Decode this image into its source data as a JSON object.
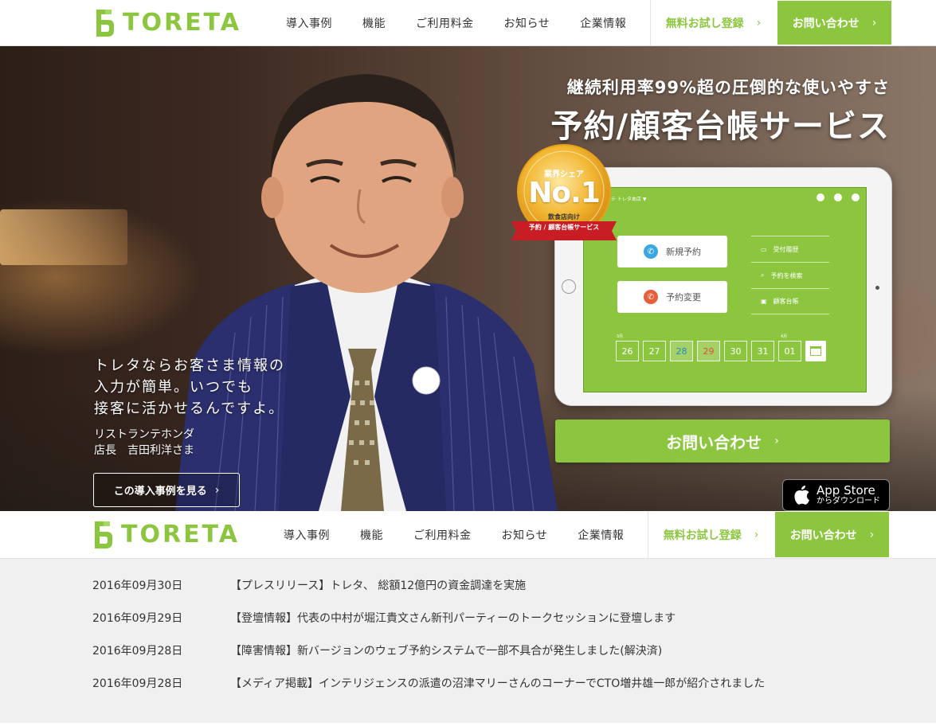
{
  "brand": {
    "name": "TORETA",
    "accent": "#8cc63f"
  },
  "nav": {
    "items": [
      "導入事例",
      "機能",
      "ご利用料金",
      "お知らせ",
      "企業情報"
    ],
    "trial_label": "無料お試し登録",
    "contact_label": "お問い合わせ",
    "chevron": "›"
  },
  "hero": {
    "tagline": "継続利用率99%超の圧倒的な使いやすさ",
    "headline": "予約/顧客台帳サービス",
    "quote": "トレタならお客さま情報の\n入力が簡単。いつでも\n接客に活かせるんですよ。",
    "quote_person": "リストランテホンダ\n店長　吉田利洋さま",
    "case_button": "この導入事例を見る",
    "contact_button": "お問い合わせ",
    "badge": {
      "top": "業界シェア",
      "main": "No.1",
      "sub1": "飲食店向け",
      "sub2": "予約 / 顧客台帳サービス"
    },
    "appstore": {
      "line1": "App Store",
      "line2": "からダウンロード"
    },
    "tablet": {
      "store_name": "ストランテ トレタ本店 ▼",
      "new_reservation": "新規予約",
      "change_reservation": "予約変更",
      "menu": [
        "受付履歴",
        "予約を検索",
        "顧客台帳"
      ],
      "month_left": "3月",
      "month_right": "4月",
      "dates": [
        "26",
        "27",
        "28",
        "29",
        "30",
        "31",
        "01"
      ]
    }
  },
  "news": [
    {
      "date": "2016年09月30日",
      "title": "【プレスリリース】トレタ、 総額12億円の資金調達を実施"
    },
    {
      "date": "2016年09月29日",
      "title": "【登壇情報】代表の中村が堀江貴文さん新刊パーティーのトークセッションに登壇します"
    },
    {
      "date": "2016年09月28日",
      "title": "【障害情報】新バージョンのウェブ予約システムで一部不具合が発生しました(解決済)"
    },
    {
      "date": "2016年09月28日",
      "title": "【メディア掲載】インテリジェンスの派遣の沼津マリーさんのコーナーでCTO増井雄一郎が紹介されました"
    }
  ]
}
